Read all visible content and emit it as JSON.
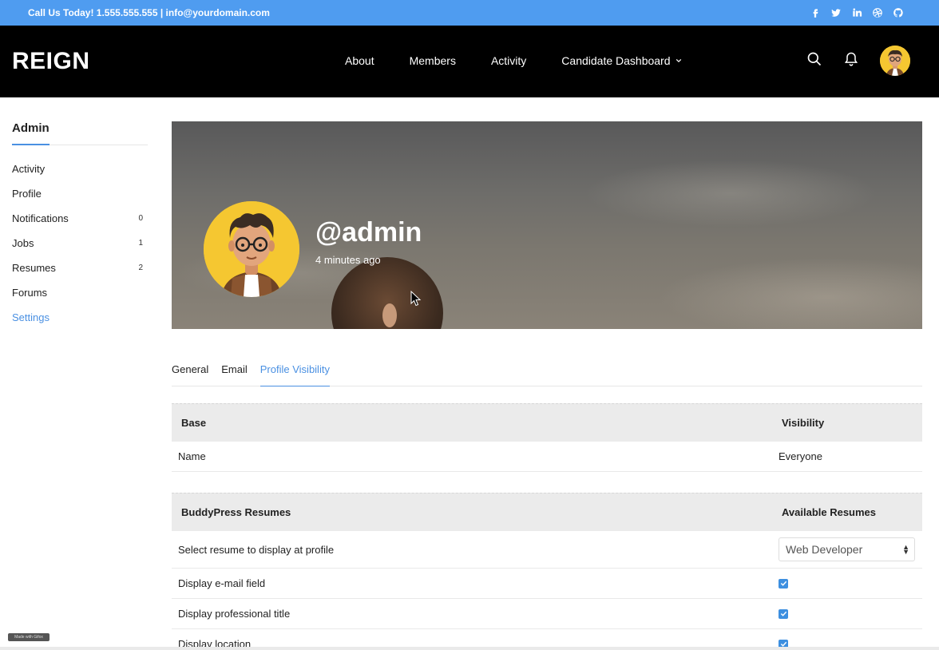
{
  "topbar": {
    "contact": "Call Us Today! 1.555.555.555 | info@yourdomain.com",
    "socials": [
      "facebook-icon",
      "twitter-icon",
      "linkedin-icon",
      "dribbble-icon",
      "github-icon"
    ]
  },
  "header": {
    "logo": "REIGN",
    "nav": [
      "About",
      "Members",
      "Activity",
      "Candidate Dashboard"
    ],
    "icons": [
      "search-icon",
      "bell-icon",
      "avatar"
    ]
  },
  "sidebar": {
    "title": "Admin",
    "items": [
      {
        "label": "Activity",
        "count": ""
      },
      {
        "label": "Profile",
        "count": ""
      },
      {
        "label": "Notifications",
        "count": "0"
      },
      {
        "label": "Jobs",
        "count": "1"
      },
      {
        "label": "Resumes",
        "count": "2"
      },
      {
        "label": "Forums",
        "count": ""
      },
      {
        "label": "Settings",
        "count": ""
      }
    ],
    "active": "Settings"
  },
  "profile": {
    "handle": "@admin",
    "last_active": "4 minutes ago"
  },
  "tabs": [
    "General",
    "Email",
    "Profile Visibility"
  ],
  "active_tab": "Profile Visibility",
  "base_table": {
    "headers": [
      "Base",
      "Visibility"
    ],
    "rows": [
      {
        "field": "Name",
        "value": "Everyone"
      }
    ]
  },
  "resumes_table": {
    "headers": [
      "BuddyPress Resumes",
      "Available Resumes"
    ],
    "select_label": "Select resume to display at profile",
    "select_value": "Web Developer",
    "rows": [
      {
        "label": "Display e-mail field",
        "checked": true
      },
      {
        "label": "Display professional title",
        "checked": true
      },
      {
        "label": "Display location",
        "checked": true
      }
    ]
  },
  "colors": {
    "topbar": "#4f9cf0",
    "header": "#000000",
    "accent": "#4a90e2",
    "avatar_bg": "#f5c731"
  },
  "giphy_badge": "Made with Gifox"
}
